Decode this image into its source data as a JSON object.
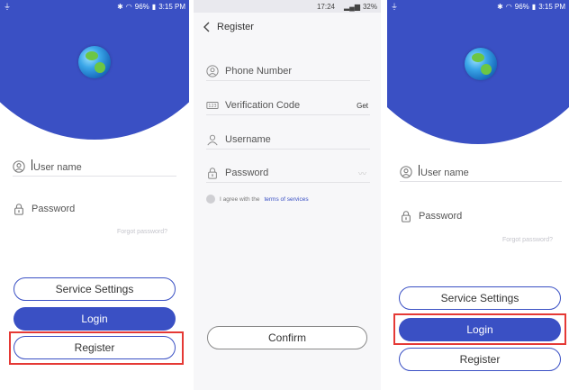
{
  "status": {
    "time": "3:15 PM",
    "battery": "96%",
    "reg_time": "17:24",
    "reg_battery": "32%"
  },
  "login": {
    "username_placeholder": "User name",
    "password_placeholder": "Password",
    "forgot_label": "Forgot password?",
    "service_settings_label": "Service Settings",
    "login_label": "Login",
    "register_label": "Register"
  },
  "register": {
    "title": "Register",
    "phone_placeholder": "Phone Number",
    "code_placeholder": "Verification Code",
    "get_label": "Get",
    "username_placeholder": "Username",
    "password_placeholder": "Password",
    "agree_prefix": "I agree with the",
    "terms_label": "terms of services",
    "confirm_label": "Confirm"
  },
  "colors": {
    "brand_blue": "#3a50c4",
    "highlight_red": "#e53935"
  },
  "icons": {
    "user": "user-icon",
    "lock": "lock-icon",
    "phone": "phone-icon",
    "code": "code-icon",
    "back": "chevron-left-icon",
    "eye": "eye-icon",
    "logo": "globe-logo-icon"
  }
}
